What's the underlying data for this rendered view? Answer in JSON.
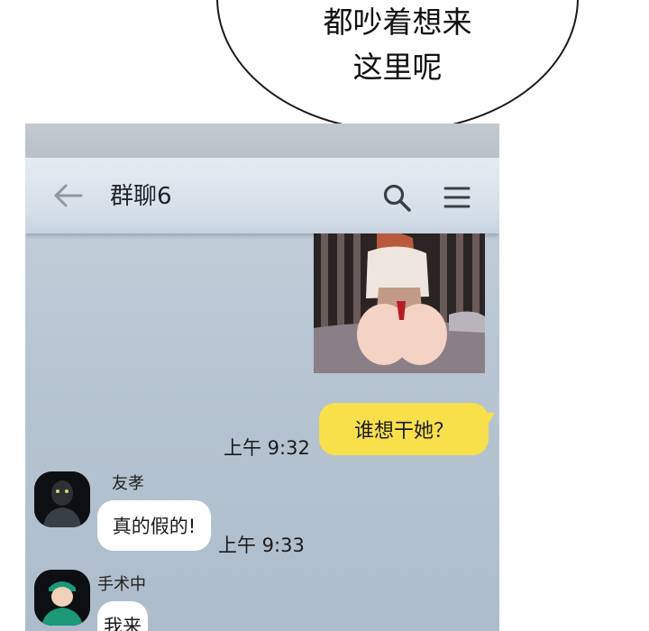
{
  "narration": {
    "text": "都吵着想来\n这里呢"
  },
  "header": {
    "title": "群聊6",
    "back_icon": "arrow-left-icon",
    "search_icon": "search-icon",
    "menu_icon": "hamburger-menu-icon"
  },
  "messages": {
    "outgoing": {
      "text": "谁想干她？",
      "time": "上午 9:32"
    },
    "msg1": {
      "sender": "友孝",
      "text": "真的假的!",
      "time": "上午 9:33"
    },
    "msg2": {
      "sender": "手术中",
      "text": "我来"
    }
  },
  "colors": {
    "outgoing_bubble": "#f7e04a",
    "incoming_bubble": "#ffffff",
    "chat_background": "#b8c6d3"
  }
}
